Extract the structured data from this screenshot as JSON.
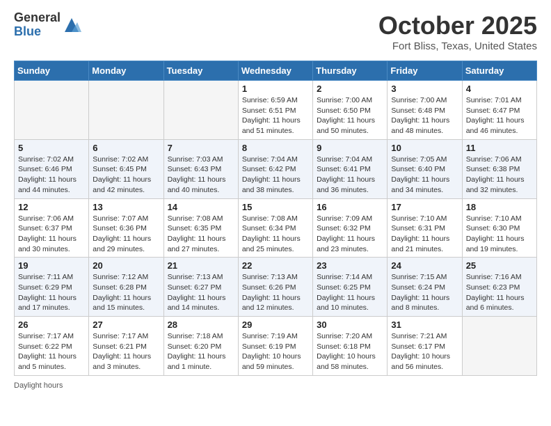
{
  "header": {
    "logo_line1": "General",
    "logo_line2": "Blue",
    "month": "October 2025",
    "location": "Fort Bliss, Texas, United States"
  },
  "weekdays": [
    "Sunday",
    "Monday",
    "Tuesday",
    "Wednesday",
    "Thursday",
    "Friday",
    "Saturday"
  ],
  "weeks": [
    [
      {
        "day": "",
        "info": ""
      },
      {
        "day": "",
        "info": ""
      },
      {
        "day": "",
        "info": ""
      },
      {
        "day": "1",
        "info": "Sunrise: 6:59 AM\nSunset: 6:51 PM\nDaylight: 11 hours\nand 51 minutes."
      },
      {
        "day": "2",
        "info": "Sunrise: 7:00 AM\nSunset: 6:50 PM\nDaylight: 11 hours\nand 50 minutes."
      },
      {
        "day": "3",
        "info": "Sunrise: 7:00 AM\nSunset: 6:48 PM\nDaylight: 11 hours\nand 48 minutes."
      },
      {
        "day": "4",
        "info": "Sunrise: 7:01 AM\nSunset: 6:47 PM\nDaylight: 11 hours\nand 46 minutes."
      }
    ],
    [
      {
        "day": "5",
        "info": "Sunrise: 7:02 AM\nSunset: 6:46 PM\nDaylight: 11 hours\nand 44 minutes."
      },
      {
        "day": "6",
        "info": "Sunrise: 7:02 AM\nSunset: 6:45 PM\nDaylight: 11 hours\nand 42 minutes."
      },
      {
        "day": "7",
        "info": "Sunrise: 7:03 AM\nSunset: 6:43 PM\nDaylight: 11 hours\nand 40 minutes."
      },
      {
        "day": "8",
        "info": "Sunrise: 7:04 AM\nSunset: 6:42 PM\nDaylight: 11 hours\nand 38 minutes."
      },
      {
        "day": "9",
        "info": "Sunrise: 7:04 AM\nSunset: 6:41 PM\nDaylight: 11 hours\nand 36 minutes."
      },
      {
        "day": "10",
        "info": "Sunrise: 7:05 AM\nSunset: 6:40 PM\nDaylight: 11 hours\nand 34 minutes."
      },
      {
        "day": "11",
        "info": "Sunrise: 7:06 AM\nSunset: 6:38 PM\nDaylight: 11 hours\nand 32 minutes."
      }
    ],
    [
      {
        "day": "12",
        "info": "Sunrise: 7:06 AM\nSunset: 6:37 PM\nDaylight: 11 hours\nand 30 minutes."
      },
      {
        "day": "13",
        "info": "Sunrise: 7:07 AM\nSunset: 6:36 PM\nDaylight: 11 hours\nand 29 minutes."
      },
      {
        "day": "14",
        "info": "Sunrise: 7:08 AM\nSunset: 6:35 PM\nDaylight: 11 hours\nand 27 minutes."
      },
      {
        "day": "15",
        "info": "Sunrise: 7:08 AM\nSunset: 6:34 PM\nDaylight: 11 hours\nand 25 minutes."
      },
      {
        "day": "16",
        "info": "Sunrise: 7:09 AM\nSunset: 6:32 PM\nDaylight: 11 hours\nand 23 minutes."
      },
      {
        "day": "17",
        "info": "Sunrise: 7:10 AM\nSunset: 6:31 PM\nDaylight: 11 hours\nand 21 minutes."
      },
      {
        "day": "18",
        "info": "Sunrise: 7:10 AM\nSunset: 6:30 PM\nDaylight: 11 hours\nand 19 minutes."
      }
    ],
    [
      {
        "day": "19",
        "info": "Sunrise: 7:11 AM\nSunset: 6:29 PM\nDaylight: 11 hours\nand 17 minutes."
      },
      {
        "day": "20",
        "info": "Sunrise: 7:12 AM\nSunset: 6:28 PM\nDaylight: 11 hours\nand 15 minutes."
      },
      {
        "day": "21",
        "info": "Sunrise: 7:13 AM\nSunset: 6:27 PM\nDaylight: 11 hours\nand 14 minutes."
      },
      {
        "day": "22",
        "info": "Sunrise: 7:13 AM\nSunset: 6:26 PM\nDaylight: 11 hours\nand 12 minutes."
      },
      {
        "day": "23",
        "info": "Sunrise: 7:14 AM\nSunset: 6:25 PM\nDaylight: 11 hours\nand 10 minutes."
      },
      {
        "day": "24",
        "info": "Sunrise: 7:15 AM\nSunset: 6:24 PM\nDaylight: 11 hours\nand 8 minutes."
      },
      {
        "day": "25",
        "info": "Sunrise: 7:16 AM\nSunset: 6:23 PM\nDaylight: 11 hours\nand 6 minutes."
      }
    ],
    [
      {
        "day": "26",
        "info": "Sunrise: 7:17 AM\nSunset: 6:22 PM\nDaylight: 11 hours\nand 5 minutes."
      },
      {
        "day": "27",
        "info": "Sunrise: 7:17 AM\nSunset: 6:21 PM\nDaylight: 11 hours\nand 3 minutes."
      },
      {
        "day": "28",
        "info": "Sunrise: 7:18 AM\nSunset: 6:20 PM\nDaylight: 11 hours\nand 1 minute."
      },
      {
        "day": "29",
        "info": "Sunrise: 7:19 AM\nSunset: 6:19 PM\nDaylight: 10 hours\nand 59 minutes."
      },
      {
        "day": "30",
        "info": "Sunrise: 7:20 AM\nSunset: 6:18 PM\nDaylight: 10 hours\nand 58 minutes."
      },
      {
        "day": "31",
        "info": "Sunrise: 7:21 AM\nSunset: 6:17 PM\nDaylight: 10 hours\nand 56 minutes."
      },
      {
        "day": "",
        "info": ""
      }
    ]
  ],
  "footer": {
    "daylight_label": "Daylight hours"
  }
}
